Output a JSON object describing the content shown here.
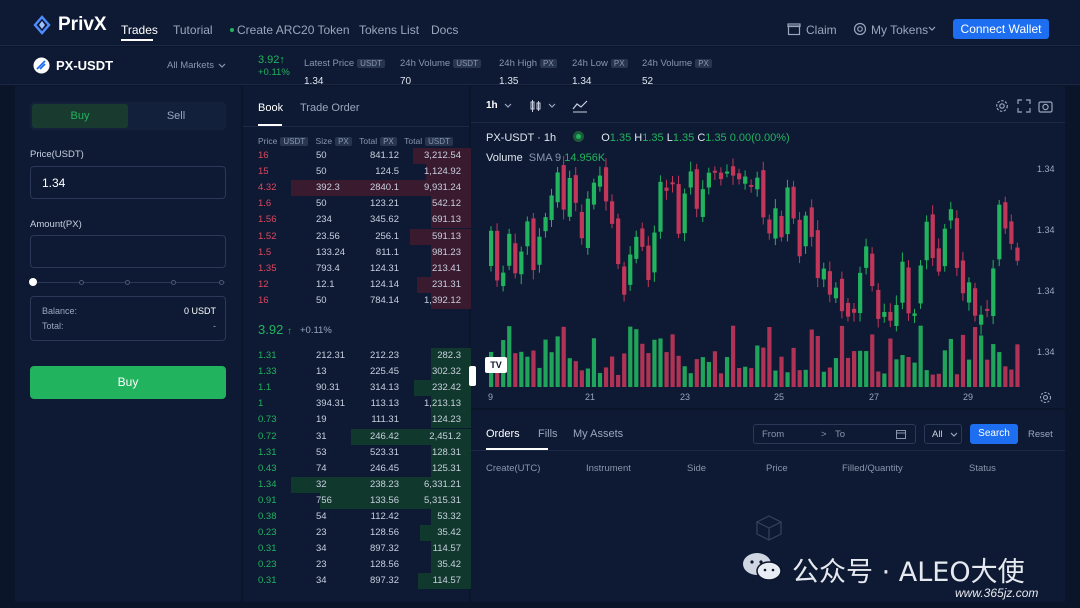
{
  "nav": {
    "brand": "PrivX",
    "links": [
      "Trades",
      "Tutorial",
      "Create ARC20 Token",
      "Tokens List",
      "Docs"
    ],
    "claim": "Claim",
    "my_tokens": "My Tokens",
    "connect": "Connect Wallet"
  },
  "pair": {
    "name": "PX-USDT",
    "markets": "All Markets",
    "price": "3.92",
    "arrow": "↑",
    "change": "+0.11%",
    "stats": [
      {
        "label": "Latest Price",
        "tag": "USDT",
        "value": "1.34"
      },
      {
        "label": "24h Volume",
        "tag": "USDT",
        "value": "70"
      },
      {
        "label": "24h High",
        "tag": "PX",
        "value": "1.35"
      },
      {
        "label": "24h Low",
        "tag": "PX",
        "value": "1.34"
      },
      {
        "label": "24h Volume",
        "tag": "PX",
        "value": "52"
      }
    ]
  },
  "trade": {
    "buy_tab": "Buy",
    "sell_tab": "Sell",
    "price_label": "Price(USDT)",
    "price_value": "1.34",
    "amount_label": "Amount(PX)",
    "balance_label": "Balance:",
    "balance_value": "0 USDT",
    "total_label": "Total:",
    "total_value": "-",
    "buy_button": "Buy"
  },
  "book": {
    "tab_book": "Book",
    "tab_trade": "Trade Order",
    "h_price": "Price",
    "h_size": "Size",
    "h_total": "Total",
    "h_total2": "Total",
    "t_usdt": "USDT",
    "t_px": "PX",
    "mid_price": "3.92",
    "mid_arrow": "↑",
    "mid_change": "+0.11%",
    "asks": [
      [
        "16",
        "50",
        "841.12",
        "3,212.54"
      ],
      [
        "15",
        "50",
        "124.5",
        "1,124.92"
      ],
      [
        "4.32",
        "392.3",
        "2840.1",
        "9,931.24"
      ],
      [
        "1.6",
        "50",
        "123.21",
        "542.12"
      ],
      [
        "1.56",
        "234",
        "345.62",
        "691.13"
      ],
      [
        "1.52",
        "23.56",
        "256.1",
        "591.13"
      ],
      [
        "1.5",
        "133.24",
        "811.1",
        "981.23"
      ],
      [
        "1.35",
        "793.4",
        "124.31",
        "213.41"
      ],
      [
        "12",
        "12.1",
        "124.14",
        "231.31"
      ],
      [
        "16",
        "50",
        "784.14",
        "1,392.12"
      ]
    ],
    "bids": [
      [
        "1.31",
        "212.31",
        "212.23",
        "282.3"
      ],
      [
        "1.33",
        "13",
        "225.45",
        "302.32"
      ],
      [
        "1.1",
        "90.31",
        "314.13",
        "232.42"
      ],
      [
        "1",
        "394.31",
        "113.13",
        "1,213.13"
      ],
      [
        "0.73",
        "19",
        "111.31",
        "124.23"
      ],
      [
        "0.72",
        "31",
        "246.42",
        "2,451.2"
      ],
      [
        "1.31",
        "53",
        "523.31",
        "128.31"
      ],
      [
        "0.43",
        "74",
        "246.45",
        "125.31"
      ],
      [
        "1.34",
        "32",
        "238.23",
        "6,331.21"
      ],
      [
        "0.91",
        "756",
        "133.56",
        "5,315.31"
      ],
      [
        "0.38",
        "54",
        "112.42",
        "53.32"
      ],
      [
        "0.23",
        "23",
        "128.56",
        "35.42"
      ],
      [
        "0.31",
        "34",
        "897.32",
        "114.57"
      ],
      [
        "0.23",
        "23",
        "128.56",
        "35.42"
      ],
      [
        "0.31",
        "34",
        "897.32",
        "114.57"
      ]
    ]
  },
  "chart": {
    "interval": "1h",
    "legend_pair": "PX-USDT · 1h",
    "o_label": "O",
    "o_val": "1.35",
    "h_label": "H",
    "h_val": "1.35",
    "l_label": "L",
    "l_val": "1.35",
    "c_label": "C",
    "c_val": "1.35 0.00(0.00%)",
    "vol_label": "Volume",
    "sma_label": "SMA 9",
    "sma_val": "14.956K",
    "y_ticks": [
      "1.34",
      "1.34",
      "1.34",
      "1.34"
    ],
    "x_ticks": [
      "9",
      "21",
      "23",
      "25",
      "27",
      "29"
    ],
    "tv": "TV",
    "colors": {
      "up": "#22b35e",
      "down": "#c2365a"
    }
  },
  "orders": {
    "tabs": [
      "Orders",
      "Fills",
      "My Assets"
    ],
    "from": "From",
    "arrow": ">",
    "to": "To",
    "all": "All",
    "search": "Search",
    "reset": "Reset",
    "cols": [
      "Create(UTC)",
      "Instrument",
      "Side",
      "Price",
      "Filled/Quantity",
      "Status"
    ]
  },
  "watermark": {
    "text": "公众号 · ALEO大使",
    "site": "www.365jz.com"
  }
}
